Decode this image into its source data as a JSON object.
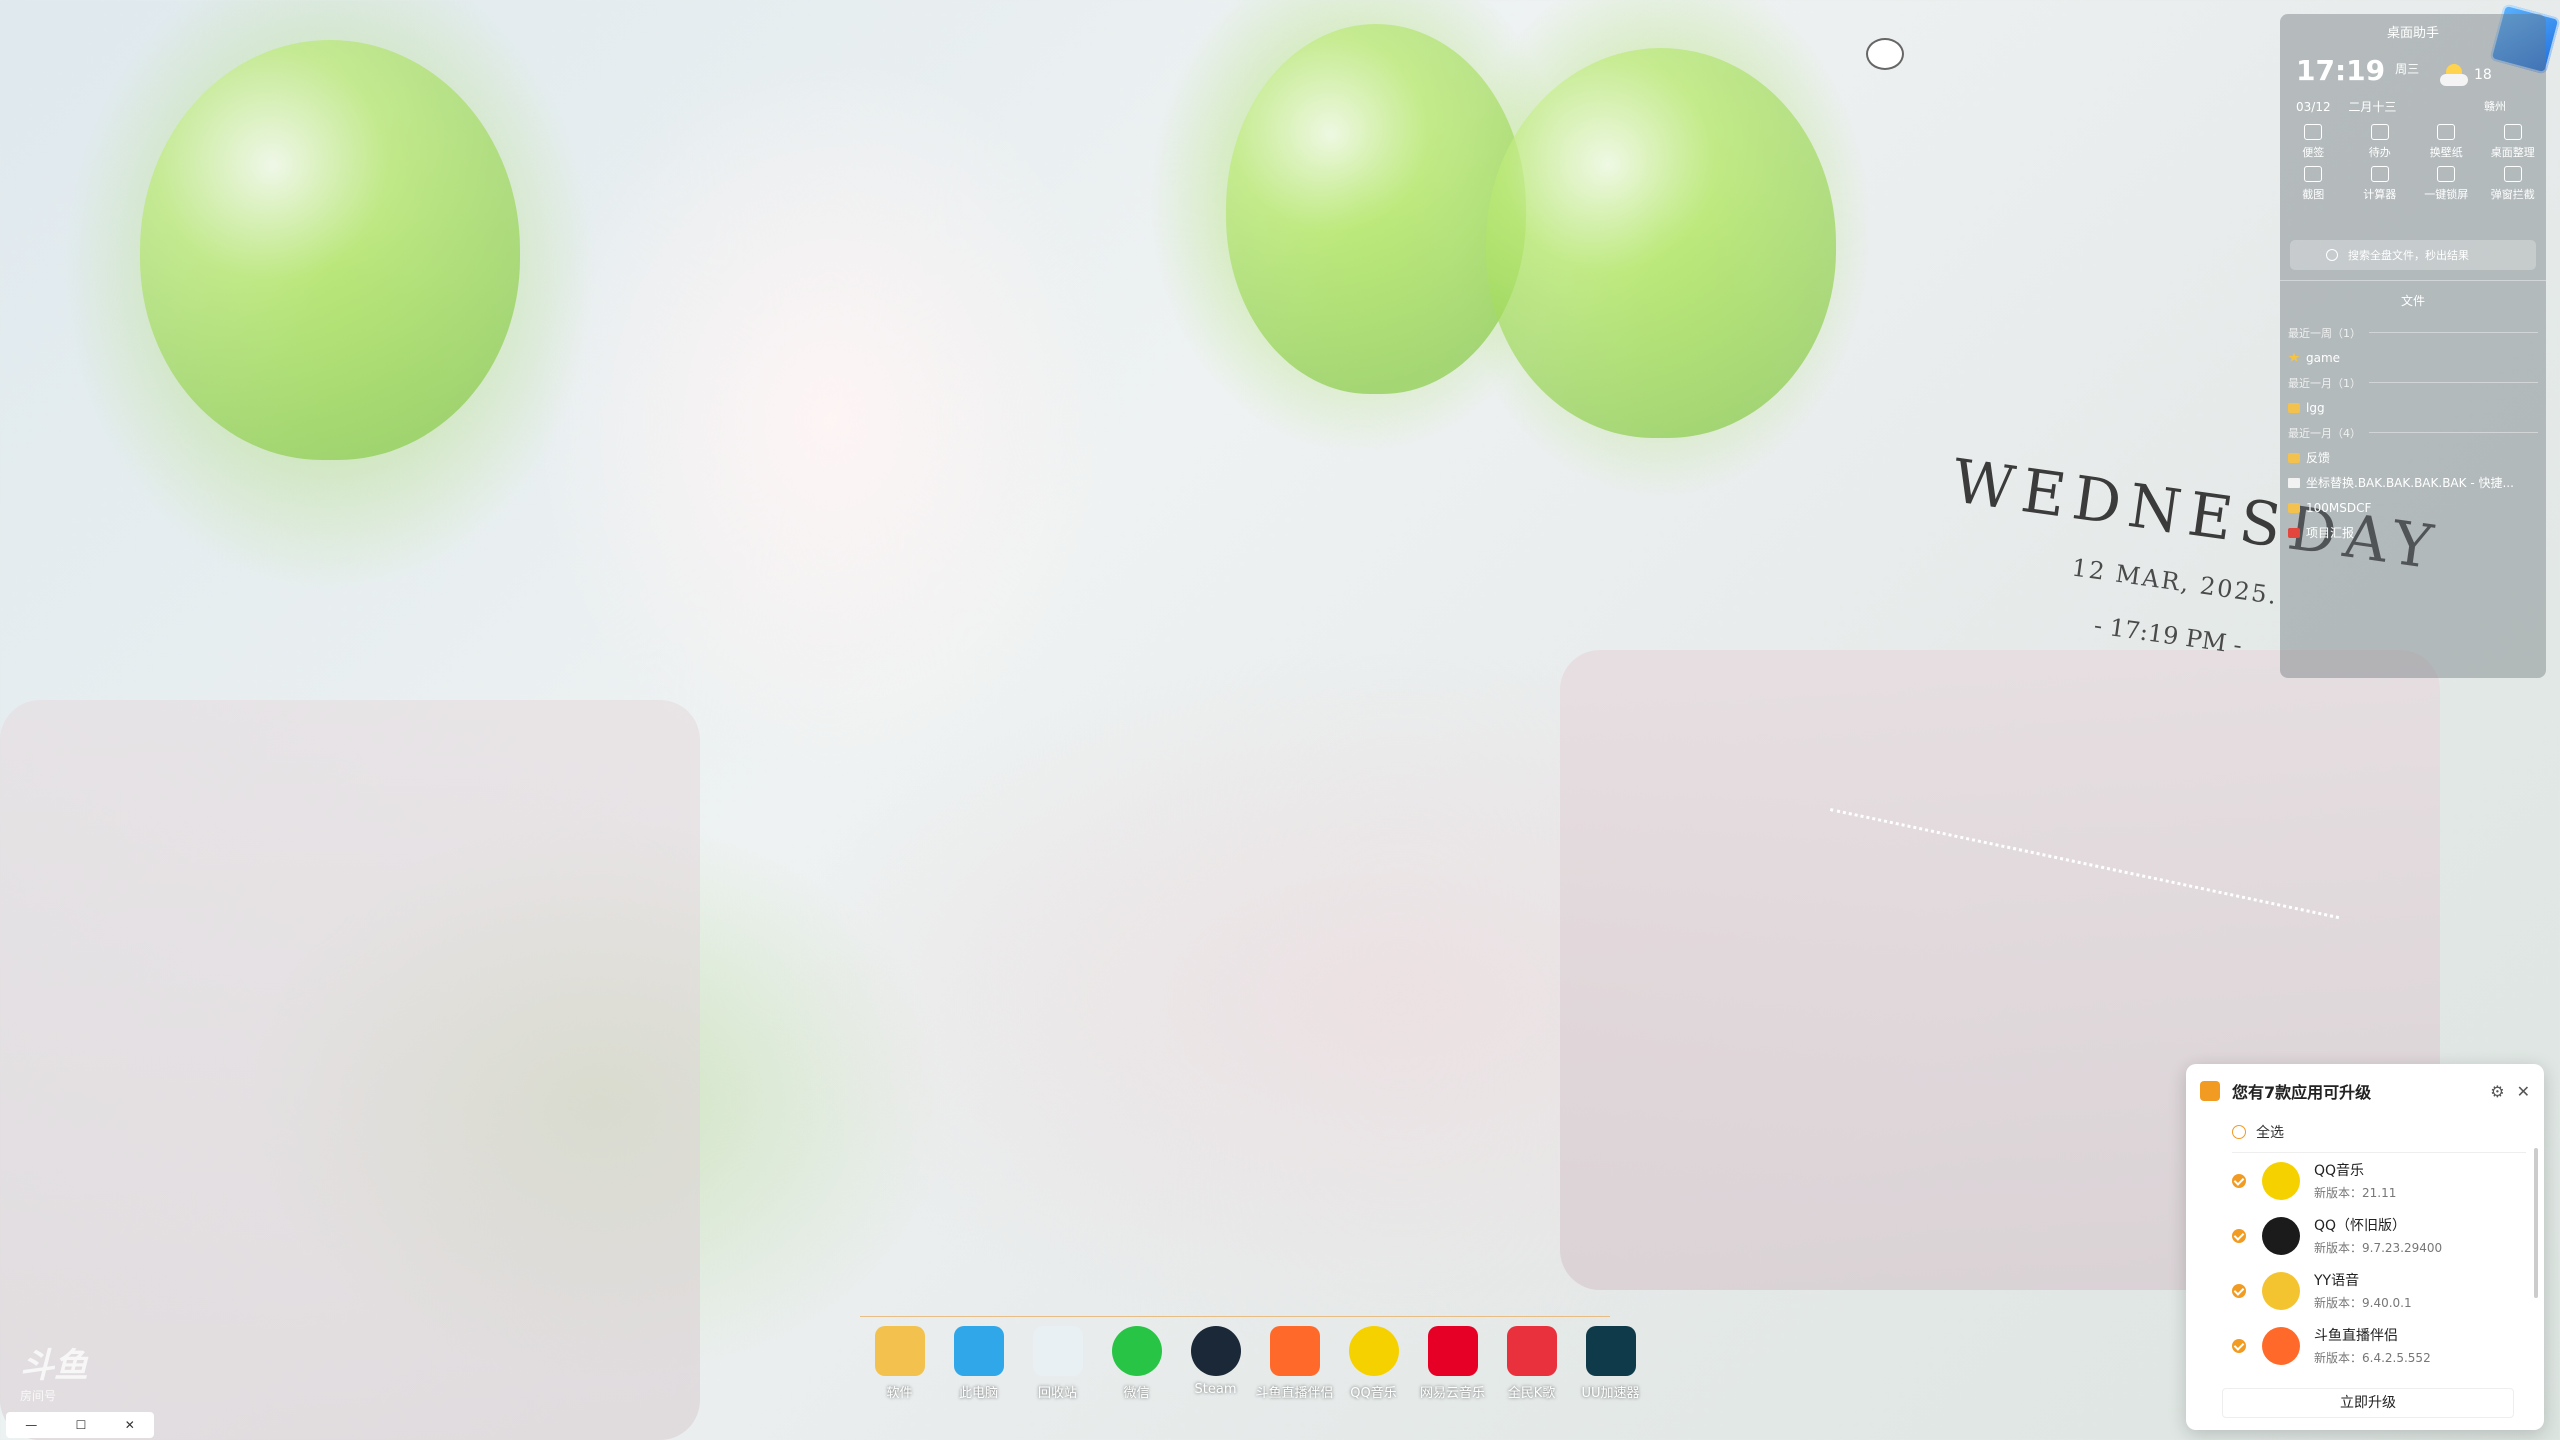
{
  "date_widget": {
    "day": "WEDNESDAY",
    "date": "12 MAR, 2025.",
    "time": "- 17:19 PM -"
  },
  "assistant": {
    "title": "桌面助手",
    "time": "17:19",
    "weekday": "周三",
    "lunar": "二月十三",
    "date": "03/12",
    "temperature": "18",
    "city": "赣州",
    "tools": [
      {
        "label": "便签",
        "icon": "note-icon"
      },
      {
        "label": "待办",
        "icon": "todo-icon"
      },
      {
        "label": "换壁纸",
        "icon": "wallpaper-icon"
      },
      {
        "label": "桌面整理",
        "icon": "organize-icon"
      },
      {
        "label": "截图",
        "icon": "screenshot-icon"
      },
      {
        "label": "计算器",
        "icon": "calculator-icon"
      },
      {
        "label": "一键锁屏",
        "icon": "lock-icon"
      },
      {
        "label": "弹窗拦截",
        "icon": "popup-block-icon"
      }
    ],
    "search_placeholder": "搜索全盘文件，秒出结果",
    "files_title": "文件",
    "files": [
      {
        "type": "group",
        "label": "最近一周（1）"
      },
      {
        "type": "star",
        "label": "game"
      },
      {
        "type": "group",
        "label": "最近一月（1）"
      },
      {
        "type": "folder",
        "label": "lgg"
      },
      {
        "type": "group",
        "label": "最近一月（4）"
      },
      {
        "type": "folder",
        "label": "反馈"
      },
      {
        "type": "doc",
        "label": "坐标替换.BAK.BAK.BAK.BAK - 快捷..."
      },
      {
        "type": "folder",
        "label": "100MSDCF"
      },
      {
        "type": "red",
        "label": "项目汇报"
      }
    ]
  },
  "upgrade": {
    "title": "您有7款应用可升级",
    "select_all": "全选",
    "apps": [
      {
        "name": "QQ音乐",
        "version": "新版本：21.11",
        "color": "#f6d100"
      },
      {
        "name": "QQ（怀旧版）",
        "version": "新版本：9.7.23.29400",
        "color": "#1b1b1b"
      },
      {
        "name": "YY语音",
        "version": "新版本：9.40.0.1",
        "color": "#f4c430"
      },
      {
        "name": "斗鱼直播伴侣",
        "version": "新版本：6.4.2.5.552",
        "color": "#ff6a2b"
      }
    ],
    "button": "立即升级"
  },
  "taskbar": [
    {
      "label": "软件",
      "color": "#f2c14e",
      "icon": "folder-icon"
    },
    {
      "label": "此电脑",
      "color": "#2fa7e8",
      "icon": "computer-icon"
    },
    {
      "label": "回收站",
      "color": "#e8f0f4",
      "icon": "recycle-bin-icon"
    },
    {
      "label": "微信",
      "color": "#28c445",
      "icon": "wechat-icon"
    },
    {
      "label": "Steam",
      "color": "#1b2838",
      "icon": "steam-icon"
    },
    {
      "label": "斗鱼直播伴侣",
      "color": "#ff6a2b",
      "icon": "douyu-icon"
    },
    {
      "label": "QQ音乐",
      "color": "#f6d100",
      "icon": "qqmusic-icon"
    },
    {
      "label": "网易云音乐",
      "color": "#e60026",
      "icon": "netease-music-icon"
    },
    {
      "label": "全民K歌",
      "color": "#e8313c",
      "icon": "kge-icon"
    },
    {
      "label": "UU加速器",
      "color": "#0f3a4a",
      "icon": "uu-icon"
    }
  ],
  "watermark": {
    "logo": "斗鱼",
    "sub": "房间号"
  }
}
